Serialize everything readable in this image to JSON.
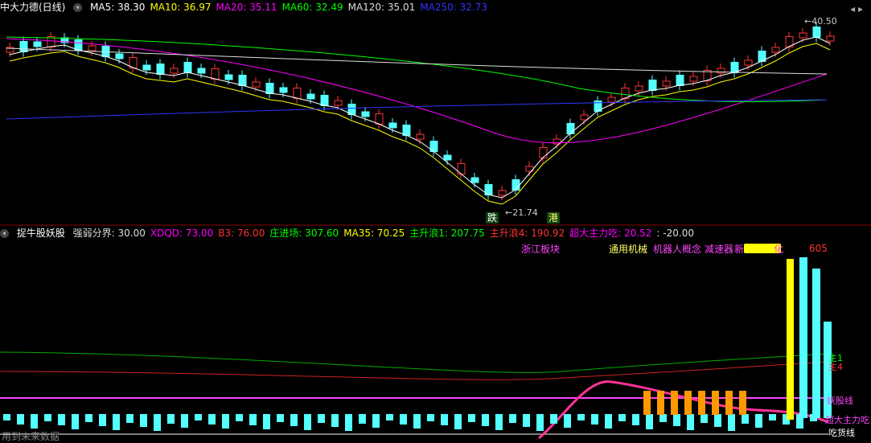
{
  "top_panel": {
    "title": "中大力德(日线)",
    "indicators": [
      {
        "label": "MA5: 38.30",
        "color": "#ffffff"
      },
      {
        "label": "MA10: 36.97",
        "color": "#ffff00"
      },
      {
        "label": "MA20: 35.11",
        "color": "#ff00ff"
      },
      {
        "label": "MA60: 32.49",
        "color": "#00ff00"
      },
      {
        "label": "MA120: 35.01",
        "color": "#dddddd"
      },
      {
        "label": "MA250: 32.73",
        "color": "#3333ff"
      }
    ],
    "high_label": "40.50",
    "low_label": "21.74",
    "badge_die": "跌",
    "badge_gang": "港"
  },
  "bottom_panel": {
    "title": "捉牛股妖股",
    "indicators": [
      {
        "label": "强弱分界: 30.00",
        "color": "#dddddd"
      },
      {
        "label": "XDQD: 73.00",
        "color": "#ff00ff"
      },
      {
        "label": "B3: 76.00",
        "color": "#ff3333"
      },
      {
        "label": "庄进场: 307.60",
        "color": "#00ff00"
      },
      {
        "label": "MA35: 70.25",
        "color": "#ffff00"
      },
      {
        "label": "主升浪1: 207.75",
        "color": "#00ff00"
      },
      {
        "label": "主升浪4: 190.92",
        "color": "#ff3333"
      },
      {
        "label": "超大主力吃: 20.52",
        "color": "#ff00ff"
      },
      {
        "label": ": -20.00",
        "color": "#dddddd"
      }
    ],
    "sectors": [
      {
        "text": "浙江板块",
        "color": "#ff44ff"
      },
      {
        "text": "通用机械",
        "color": "#ffff66"
      },
      {
        "text": "机器人概念",
        "color": "#ff44ff"
      },
      {
        "text": "减速器",
        "color": "#ff44ff"
      },
      {
        "text": "新",
        "color": "#ff44ff"
      },
      {
        "text": "化",
        "color": "#ff44ff"
      }
    ],
    "value_605": "605",
    "right_labels": [
      {
        "text": "主1",
        "color": "#00ff00"
      },
      {
        "text": "主4",
        "color": "#ff3333"
      },
      {
        "text": "妖股线",
        "color": "#ff44ff"
      },
      {
        "text": "超大主力吃",
        "color": "#ff44ff"
      },
      {
        "text": "吃货线",
        "color": "#ffffff"
      }
    ],
    "footer_text": "用到未来数据"
  },
  "colors": {
    "up": "#ff3333",
    "down": "#54ffff",
    "background": "#000000"
  }
}
